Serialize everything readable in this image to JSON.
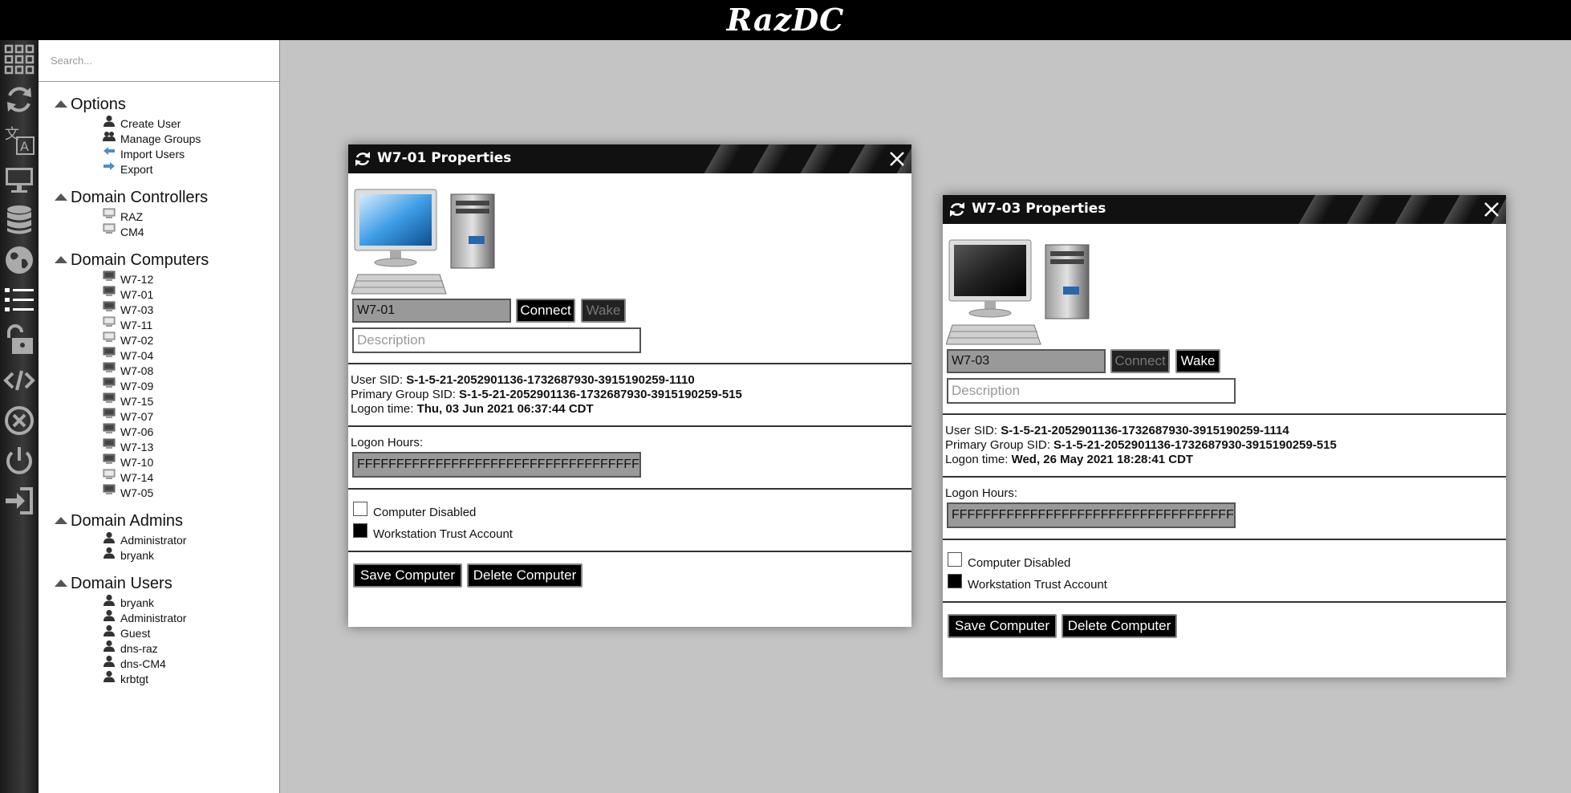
{
  "app": {
    "logo": "RazDC"
  },
  "search": {
    "placeholder": "Search..."
  },
  "sidebar": {
    "options": {
      "title": "Options",
      "items": [
        "Create User",
        "Manage Groups",
        "Import Users",
        "Export"
      ]
    },
    "domain_controllers": {
      "title": "Domain Controllers",
      "items": [
        "RAZ",
        "CM4"
      ]
    },
    "domain_computers": {
      "title": "Domain Computers",
      "items": [
        "W7-12",
        "W7-01",
        "W7-03",
        "W7-11",
        "W7-02",
        "W7-04",
        "W7-08",
        "W7-09",
        "W7-15",
        "W7-07",
        "W7-06",
        "W7-13",
        "W7-10",
        "W7-14",
        "W7-05"
      ]
    },
    "domain_admins": {
      "title": "Domain Admins",
      "items": [
        "Administrator",
        "bryank"
      ]
    },
    "domain_users": {
      "title": "Domain Users",
      "items": [
        "bryank",
        "Administrator",
        "Guest",
        "dns-raz",
        "dns-CM4",
        "krbtgt"
      ]
    }
  },
  "windows": [
    {
      "title": "W7-01 Properties",
      "name": "W7-01",
      "connect_label": "Connect",
      "wake_label": "Wake",
      "connect_enabled": true,
      "wake_enabled": false,
      "description_placeholder": "Description",
      "user_sid_label": "User SID:",
      "user_sid": "S-1-5-21-2052901136-1732687930-3915190259-1110",
      "primary_group_label": "Primary Group SID:",
      "primary_group_sid": "S-1-5-21-2052901136-1732687930-3915190259-515",
      "logon_time_label": "Logon time:",
      "logon_time": "Thu, 03 Jun 2021 06:37:44 CDT",
      "logon_hours_label": "Logon Hours:",
      "logon_hours": "FFFFFFFFFFFFFFFFFFFFFFFFFFFFFFFFFFFFFFFFFF",
      "computer_disabled_label": "Computer Disabled",
      "computer_disabled": false,
      "trust_label": "Workstation Trust Account",
      "trust_account": true,
      "save_label": "Save Computer",
      "delete_label": "Delete Computer"
    },
    {
      "title": "W7-03 Properties",
      "name": "W7-03",
      "connect_label": "Connect",
      "wake_label": "Wake",
      "connect_enabled": false,
      "wake_enabled": true,
      "description_placeholder": "Description",
      "user_sid_label": "User SID:",
      "user_sid": "S-1-5-21-2052901136-1732687930-3915190259-1114",
      "primary_group_label": "Primary Group SID:",
      "primary_group_sid": "S-1-5-21-2052901136-1732687930-3915190259-515",
      "logon_time_label": "Logon time:",
      "logon_time": "Wed, 26 May 2021 18:28:41 CDT",
      "logon_hours_label": "Logon Hours:",
      "logon_hours": "FFFFFFFFFFFFFFFFFFFFFFFFFFFFFFFFFFFFFFFFFF",
      "computer_disabled_label": "Computer Disabled",
      "computer_disabled": false,
      "trust_label": "Workstation Trust Account",
      "trust_account": true,
      "save_label": "Save Computer",
      "delete_label": "Delete Computer"
    }
  ],
  "iconbar": [
    "apps-grid-icon",
    "refresh-icon",
    "translate-icon",
    "computer-icon",
    "database-icon",
    "globe-icon",
    "list-icon",
    "unlock-icon",
    "code-icon",
    "cancel-circle-icon",
    "power-icon",
    "sign-in-icon"
  ]
}
